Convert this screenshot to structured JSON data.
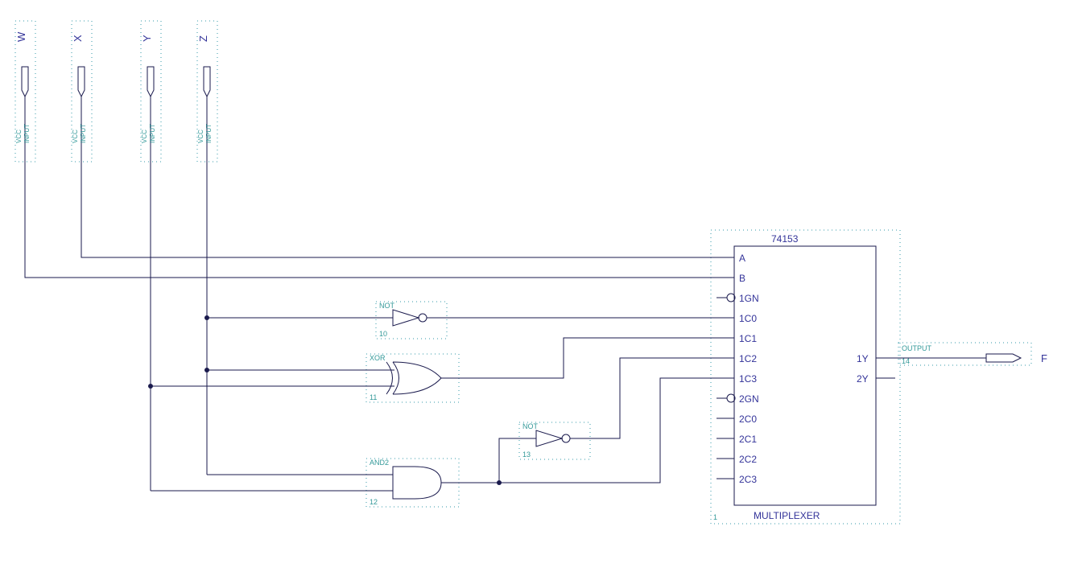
{
  "inputs": {
    "W": {
      "name": "W",
      "vcc": "VCC",
      "type": "INPUT"
    },
    "X": {
      "name": "X",
      "vcc": "VCC",
      "type": "INPUT"
    },
    "Y": {
      "name": "Y",
      "vcc": "VCC",
      "type": "INPUT"
    },
    "Z": {
      "name": "Z",
      "vcc": "VCC",
      "type": "INPUT"
    }
  },
  "gates": {
    "not10": {
      "type": "NOT",
      "id": "10"
    },
    "xor11": {
      "type": "XOR",
      "id": "11"
    },
    "and12": {
      "type": "AND2",
      "id": "12"
    },
    "not13": {
      "type": "NOT",
      "id": "13"
    }
  },
  "mux": {
    "part": "74153",
    "label": "MULTIPLEXER",
    "inst": "1",
    "pins_left": [
      "A",
      "B",
      "1GN",
      "1C0",
      "1C1",
      "1C2",
      "1C3",
      "2GN",
      "2C0",
      "2C1",
      "2C2",
      "2C3"
    ],
    "pins_right": [
      "1Y",
      "2Y"
    ]
  },
  "output": {
    "name": "F",
    "type": "OUTPUT",
    "id": "14"
  }
}
